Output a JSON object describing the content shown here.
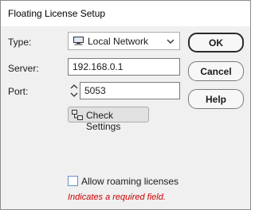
{
  "window": {
    "title": "Floating License Setup"
  },
  "form": {
    "type_label": "Type:",
    "type_value": "Local Network",
    "type_icon": "computer-icon",
    "server_label": "Server:",
    "server_value": "192.168.0.1",
    "port_label": "Port:",
    "port_value": "5053",
    "check_settings_label": "Check Settings",
    "check_settings_icon": "network-icon"
  },
  "buttons": {
    "ok_label": "OK",
    "cancel_label": "Cancel",
    "help_label": "Help"
  },
  "options": {
    "allow_roaming_label": "Allow roaming licenses",
    "allow_roaming_checked": false
  },
  "footer": {
    "required_note": "Indicates a required field.",
    "required_color": "#cc0000"
  }
}
